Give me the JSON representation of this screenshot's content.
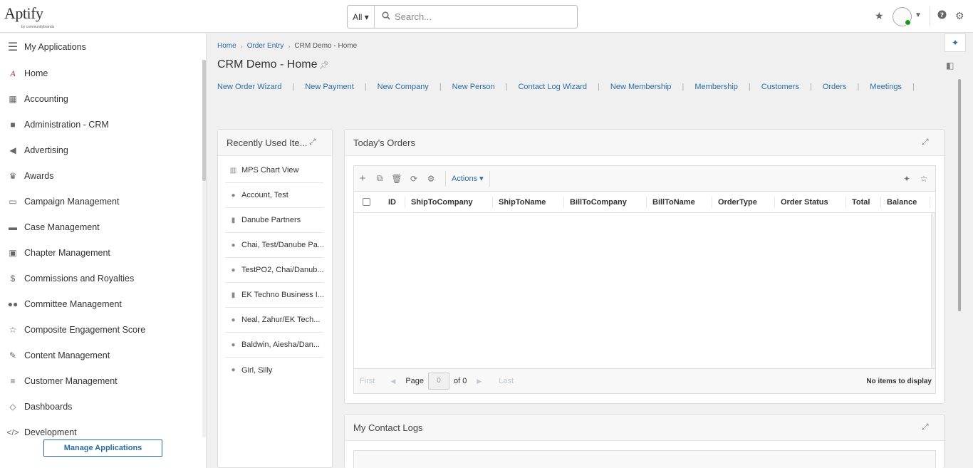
{
  "header": {
    "logo_text": "Aptify",
    "logo_sub": "by communitybrands",
    "search_scope": "All ▾",
    "search_placeholder": "Search..."
  },
  "sidebar": {
    "title": "My Applications",
    "items": [
      {
        "label": "Home",
        "icon": "home-icon"
      },
      {
        "label": "Accounting",
        "icon": "calculator-icon"
      },
      {
        "label": "Administration - CRM",
        "icon": "briefcase-icon"
      },
      {
        "label": "Advertising",
        "icon": "megaphone-icon"
      },
      {
        "label": "Awards",
        "icon": "trophy-icon"
      },
      {
        "label": "Campaign Management",
        "icon": "monitor-icon"
      },
      {
        "label": "Case Management",
        "icon": "folder-icon"
      },
      {
        "label": "Chapter Management",
        "icon": "contact-card-icon"
      },
      {
        "label": "Commissions and Royalties",
        "icon": "dollar-icon"
      },
      {
        "label": "Committee Management",
        "icon": "users-icon"
      },
      {
        "label": "Composite Engagement Score",
        "icon": "star-half-icon"
      },
      {
        "label": "Content Management",
        "icon": "pencil-icon"
      },
      {
        "label": "Customer Management",
        "icon": "list-icon"
      },
      {
        "label": "Dashboards",
        "icon": "diamond-icon"
      },
      {
        "label": "Development",
        "icon": "code-icon"
      }
    ],
    "manage_button": "Manage Applications"
  },
  "breadcrumb": {
    "items": [
      "Home",
      "Order Entry",
      "CRM Demo - Home"
    ]
  },
  "page": {
    "title": "CRM Demo - Home"
  },
  "quicklinks": [
    "New Order Wizard",
    "New Payment",
    "New Company",
    "New Person",
    "Contact Log Wizard",
    "New Membership",
    "Membership",
    "Customers",
    "Orders",
    "Meetings"
  ],
  "recent_panel": {
    "title": "Recently Used Ite...",
    "items": [
      {
        "label": "MPS Chart View",
        "icon": "bar-chart-icon"
      },
      {
        "label": "Account, Test",
        "icon": "person-icon"
      },
      {
        "label": "Danube Partners",
        "icon": "building-icon"
      },
      {
        "label": "Chai, Test/Danube Pa...",
        "icon": "person-icon"
      },
      {
        "label": "TestPO2, Chai/Danub...",
        "icon": "person-icon"
      },
      {
        "label": "EK Techno Business I...",
        "icon": "building-icon"
      },
      {
        "label": "Neal, Zahur/EK Tech...",
        "icon": "person-icon"
      },
      {
        "label": "Baldwin, Aiesha/Dan...",
        "icon": "person-icon"
      },
      {
        "label": "Girl, Silly",
        "icon": "person-icon"
      }
    ]
  },
  "orders_panel": {
    "title": "Today's Orders",
    "actions_label": "Actions ▾",
    "columns": [
      "ID",
      "ShipToCompany",
      "ShipToName",
      "BillToCompany",
      "BillToName",
      "OrderType",
      "Order Status",
      "Total",
      "Balance"
    ],
    "pager": {
      "first": "First",
      "page_label": "Page",
      "page_value": "0",
      "of_label": "of 0",
      "last": "Last",
      "status": "No items to display"
    }
  },
  "contact_logs_panel": {
    "title": "My Contact Logs"
  },
  "colors": {
    "link": "#2b6ca3",
    "status_online": "#1a9c1a"
  }
}
